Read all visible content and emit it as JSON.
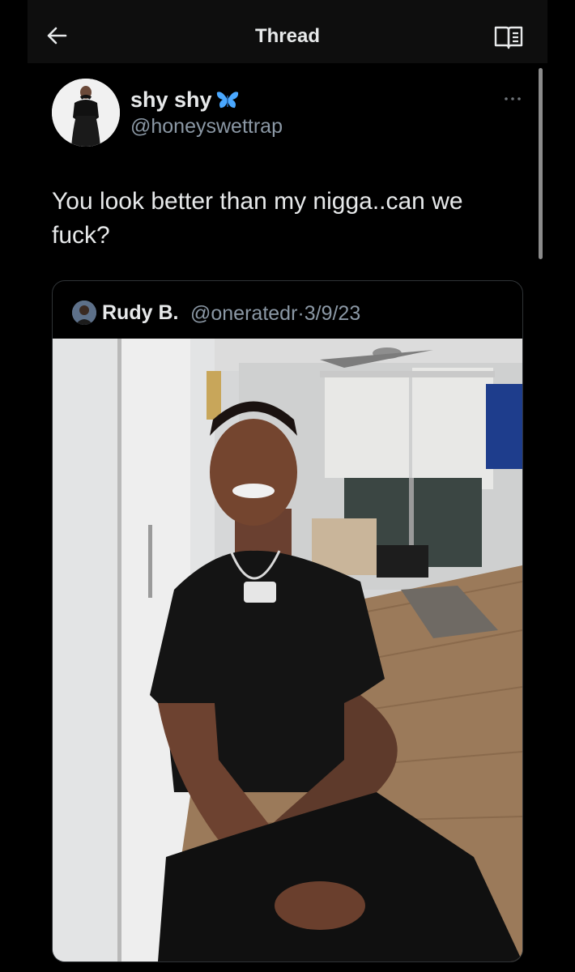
{
  "header": {
    "title": "Thread",
    "back_icon": "arrow-left-icon",
    "reader_icon": "reader-mode-icon"
  },
  "tweet": {
    "author_name": "shy shy",
    "author_badge_icon": "butterfly-icon",
    "author_handle": "@honeyswettrap",
    "text": "You look better than my nigga..can we fuck?",
    "more_icon": "more-dots-icon"
  },
  "quoted_tweet": {
    "author_name": "Rudy B.",
    "author_handle": "@oneratedr",
    "separator": "·",
    "date": "3/9/23",
    "handle_line": "@oneratedr·3/9/23",
    "media": "photo"
  },
  "colors": {
    "background": "#000000",
    "top_bar": "#0e0e0e",
    "primary_text": "#e7e9ea",
    "secondary_text": "#8b98a5",
    "border": "#2f3336",
    "badge_blue": "#4aa8ff"
  }
}
